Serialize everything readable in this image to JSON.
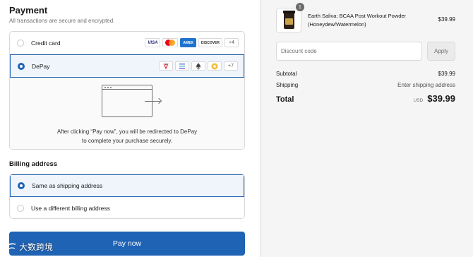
{
  "payment": {
    "title": "Payment",
    "subtitle": "All transactions are secure and encrypted.",
    "methods": [
      {
        "label": "Credit card",
        "selected": false,
        "badges": [
          "VISA",
          "mastercard",
          "AMERICAN EXPRESS",
          "DISCOVER",
          "+4"
        ]
      },
      {
        "label": "DePay",
        "selected": true,
        "badges": [
          "crypto-token-1",
          "crypto-token-2",
          "ethereum",
          "crypto-token-4",
          "+7"
        ]
      }
    ],
    "redirect_text": "After clicking “Pay now”, you will be redirected to DePay to complete your purchase securely."
  },
  "billing": {
    "title": "Billing address",
    "options": [
      {
        "label": "Same as shipping address",
        "selected": true
      },
      {
        "label": "Use a different billing address",
        "selected": false
      }
    ]
  },
  "pay_button": "Pay now",
  "watermark": "大数跨境",
  "order": {
    "product": {
      "name": "Earth Saliva: BCAA Post Workout Powder (Honeydew/Watermelon)",
      "quantity": "1",
      "price": "$39.99"
    },
    "discount": {
      "placeholder": "Discount code",
      "apply_label": "Apply"
    },
    "subtotal": {
      "label": "Subtotal",
      "value": "$39.99"
    },
    "shipping": {
      "label": "Shipping",
      "value": "Enter shipping address"
    },
    "total": {
      "label": "Total",
      "currency": "USD",
      "value": "$39.99"
    }
  },
  "colors": {
    "accent": "#1f63b5",
    "summary_bg": "#f5f5f5"
  }
}
